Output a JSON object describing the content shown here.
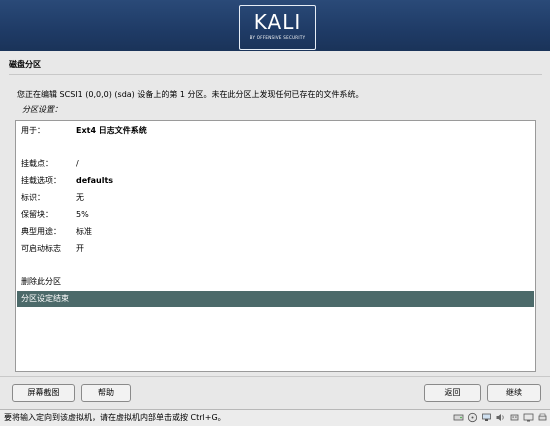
{
  "banner": {
    "logo_text": "KALI",
    "logo_sub": "BY OFFENSIVE SECURITY"
  },
  "header": {
    "title": "磁盘分区"
  },
  "main": {
    "description": "您正在编辑 SCSI1 (0,0,0) (sda) 设备上的第 1 分区。未在此分区上发现任何已存在的文件系统。",
    "section_label": "分区设置：",
    "settings": [
      {
        "label": "用于：",
        "value": "Ext4 日志文件系统"
      },
      {
        "label": "挂载点：",
        "value": "/"
      },
      {
        "label": "挂载选项：",
        "value": "defaults"
      },
      {
        "label": "标识：",
        "value": "无"
      },
      {
        "label": "保留块：",
        "value": "5%"
      },
      {
        "label": "典型用途：",
        "value": "标准"
      },
      {
        "label": "可启动标志",
        "value": "开"
      }
    ],
    "delete_item": "删除此分区",
    "done_item": "分区设定结束"
  },
  "buttons": {
    "screenshot": "屏幕截图",
    "help": "帮助",
    "back": "返回",
    "continue": "继续"
  },
  "statusbar": {
    "message": "要将输入定向到该虚拟机，请在虚拟机内部单击或按 Ctrl+G。",
    "tray_icons": [
      "hard-disk-icon",
      "cd-drive-icon",
      "network-icon",
      "sound-icon",
      "usb-icon",
      "display-icon",
      "printer-icon"
    ]
  },
  "colors": {
    "banner": "#1f3b66",
    "selection": "#4c6a6a"
  }
}
